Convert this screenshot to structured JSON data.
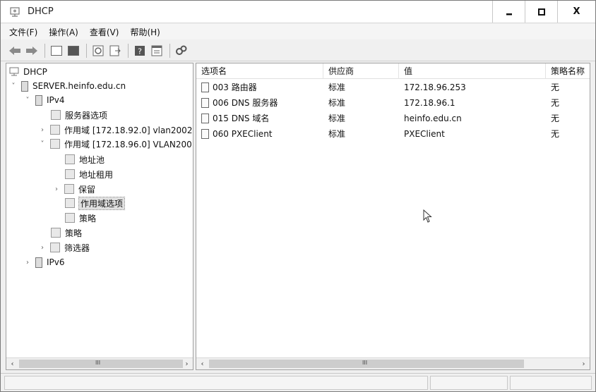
{
  "window": {
    "title": "DHCP"
  },
  "menu": [
    "文件(F)",
    "操作(A)",
    "查看(V)",
    "帮助(H)"
  ],
  "tree": {
    "nodes": [
      {
        "label": "DHCP",
        "icon": "dhcp-icon"
      },
      {
        "label": "SERVER.heinfo.edu.cn",
        "arrow": "˅",
        "icon": "server-icon"
      },
      {
        "label": "IPv4",
        "arrow": "˅",
        "icon": "ipv4-icon"
      },
      {
        "label": "服务器选项",
        "icon": "server-options-icon"
      },
      {
        "label": "作用域 [172.18.92.0] vlan2002",
        "arrow": "›",
        "icon": "folder-icon"
      },
      {
        "label": "作用域 [172.18.96.0] VLAN200",
        "arrow": "˅",
        "icon": "folder-icon"
      },
      {
        "label": "地址池",
        "icon": "address-pool-icon"
      },
      {
        "label": "地址租用",
        "icon": "address-lease-icon"
      },
      {
        "label": "保留",
        "arrow": "›",
        "icon": "reservation-icon"
      },
      {
        "label": "作用域选项",
        "icon": "scope-options-icon",
        "selected": true
      },
      {
        "label": "策略",
        "icon": "policy-icon"
      },
      {
        "label": "策略",
        "icon": "policy-icon"
      },
      {
        "label": "筛选器",
        "arrow": "›",
        "icon": "filter-icon"
      },
      {
        "label": "IPv6",
        "arrow": "›",
        "icon": "ipv6-icon"
      }
    ]
  },
  "list": {
    "columns": [
      "选项名",
      "供应商",
      "值",
      "策略名称"
    ],
    "rows": [
      [
        "003 路由器",
        "标准",
        "172.18.96.253",
        "无"
      ],
      [
        "006 DNS 服务器",
        "标准",
        "172.18.96.1",
        "无"
      ],
      [
        "015 DNS 域名",
        "标准",
        "heinfo.edu.cn",
        "无"
      ],
      [
        "060 PXEClient",
        "标准",
        "PXEClient",
        "无"
      ]
    ]
  },
  "scroll": {
    "grip": "III"
  },
  "window_buttons": {
    "minimize": "—",
    "maximize": "☐",
    "close": "X"
  }
}
